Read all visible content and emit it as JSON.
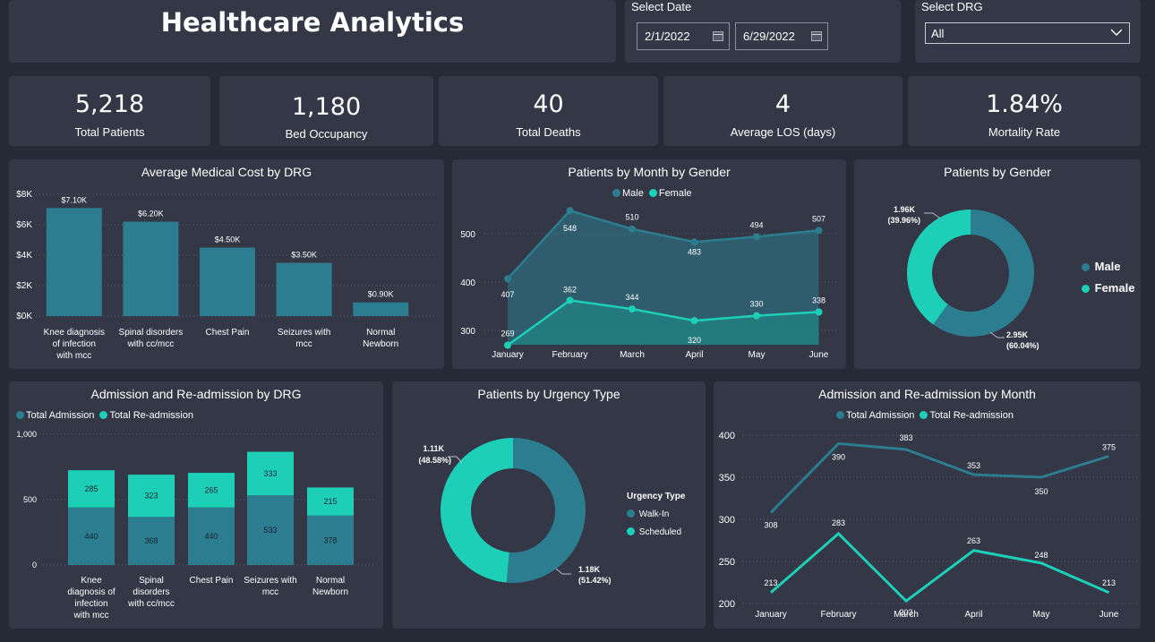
{
  "header": {
    "title": "Healthcare Analytics",
    "date_label": "Select Date",
    "date_start": "2/1/2022",
    "date_end": "6/29/2022",
    "drg_label": "Select DRG",
    "drg_value": "All"
  },
  "kpis": [
    {
      "value": "5,218",
      "label": "Total Patients"
    },
    {
      "value": "1,180",
      "label": "Bed Occupancy"
    },
    {
      "value": "40",
      "label": "Total Deaths"
    },
    {
      "value": "4",
      "label": "Average LOS (days)"
    },
    {
      "value": "1.84%",
      "label": "Mortality Rate"
    }
  ],
  "colors": {
    "teal_dark": "#2b7d8f",
    "teal_light": "#1ecfb8",
    "card": "#333746",
    "background": "#252a36"
  },
  "legends": {
    "gender_month": [
      "Male",
      "Female"
    ],
    "gender": [
      "Male",
      "Female"
    ],
    "adm_drg": [
      "Total Admission",
      "Total Re-admission"
    ],
    "urgency_title": "Urgency Type",
    "urgency": [
      "Walk-In",
      "Scheduled"
    ],
    "adm_month": [
      "Total Admission",
      "Total Re-admission"
    ]
  },
  "chart_data": [
    {
      "id": "cost",
      "type": "bar",
      "title": "Average Medical Cost by DRG",
      "categories": [
        [
          "Knee diagnosis",
          "of infection",
          "with mcc"
        ],
        [
          "Spinal disorders",
          "with cc/mcc"
        ],
        [
          "Chest Pain"
        ],
        [
          "Seizures with",
          "mcc"
        ],
        [
          "Normal",
          "Newborn"
        ]
      ],
      "values": [
        7100,
        6200,
        4500,
        3500,
        900
      ],
      "data_labels": [
        "$7.10K",
        "$6.20K",
        "$4.50K",
        "$3.50K",
        "$0.90K"
      ],
      "yticks": [
        {
          "v": 0,
          "l": "$0K"
        },
        {
          "v": 2000,
          "l": "$2K"
        },
        {
          "v": 4000,
          "l": "$4K"
        },
        {
          "v": 6000,
          "l": "$6K"
        },
        {
          "v": 8000,
          "l": "$8K"
        }
      ],
      "ylim": [
        0,
        8000
      ]
    },
    {
      "id": "month_gender",
      "type": "area",
      "title": "Patients by Month by Gender",
      "categories": [
        "January",
        "February",
        "March",
        "April",
        "May",
        "June"
      ],
      "series": [
        {
          "name": "Male",
          "values": [
            407,
            548,
            510,
            483,
            494,
            507
          ],
          "labels": [
            "407",
            "548",
            "510",
            "483",
            "494",
            "507"
          ]
        },
        {
          "name": "Female",
          "values": [
            269,
            362,
            344,
            320,
            330,
            338
          ],
          "labels": [
            "269",
            "362",
            "344",
            "320",
            "330",
            "338"
          ]
        }
      ],
      "yticks": [
        {
          "v": 300,
          "l": "300"
        },
        {
          "v": 400,
          "l": "400"
        },
        {
          "v": 500,
          "l": "500"
        }
      ],
      "ylim": [
        270,
        580
      ]
    },
    {
      "id": "gender",
      "type": "pie",
      "title": "Patients by Gender",
      "slices": [
        {
          "name": "Male",
          "value": 2.95,
          "pct": 60.04,
          "label": "2.95K",
          "pct_label": "(60.04%)"
        },
        {
          "name": "Female",
          "value": 1.96,
          "pct": 39.96,
          "label": "1.96K",
          "pct_label": "(39.96%)"
        }
      ]
    },
    {
      "id": "adm_drg",
      "type": "bar",
      "title": "Admission and Re-admission by DRG",
      "categories": [
        [
          "Knee",
          "diagnosis of",
          "infection",
          "with mcc"
        ],
        [
          "Spinal",
          "disorders",
          "with cc/mcc"
        ],
        [
          "Chest Pain"
        ],
        [
          "Seizures with",
          "mcc"
        ],
        [
          "Normal",
          "Newborn"
        ]
      ],
      "series": [
        {
          "name": "Total Admission",
          "values": [
            440,
            368,
            440,
            533,
            378
          ]
        },
        {
          "name": "Total Re-admission",
          "values": [
            285,
            323,
            265,
            333,
            215
          ]
        }
      ],
      "yticks": [
        {
          "v": 0,
          "l": "0"
        },
        {
          "v": 500,
          "l": "500"
        },
        {
          "v": 1000,
          "l": "1,000"
        }
      ],
      "ylim": [
        0,
        1000
      ]
    },
    {
      "id": "urgency",
      "type": "pie",
      "title": "Patients by Urgency Type",
      "slices": [
        {
          "name": "Walk-In",
          "value": 1.18,
          "pct": 51.42,
          "label": "1.18K",
          "pct_label": "(51.42%)"
        },
        {
          "name": "Scheduled",
          "value": 1.11,
          "pct": 48.58,
          "label": "1.11K",
          "pct_label": "(48.58%)"
        }
      ]
    },
    {
      "id": "adm_month",
      "type": "line",
      "title": "Admission and Re-admission by Month",
      "categories": [
        "January",
        "February",
        "March",
        "April",
        "May",
        "June"
      ],
      "series": [
        {
          "name": "Total Admission",
          "values": [
            308,
            390,
            383,
            353,
            350,
            375
          ],
          "labels": [
            "308",
            "390",
            "383",
            "353",
            "350",
            "375"
          ]
        },
        {
          "name": "Total Re-admission",
          "values": [
            213,
            283,
            203,
            263,
            248,
            213
          ],
          "labels": [
            "213",
            "283",
            "203",
            "263",
            "248",
            "213"
          ]
        }
      ],
      "yticks": [
        {
          "v": 200,
          "l": "200"
        },
        {
          "v": 250,
          "l": "250"
        },
        {
          "v": 300,
          "l": "300"
        },
        {
          "v": 350,
          "l": "350"
        },
        {
          "v": 400,
          "l": "400"
        }
      ],
      "ylim": [
        200,
        400
      ]
    }
  ]
}
